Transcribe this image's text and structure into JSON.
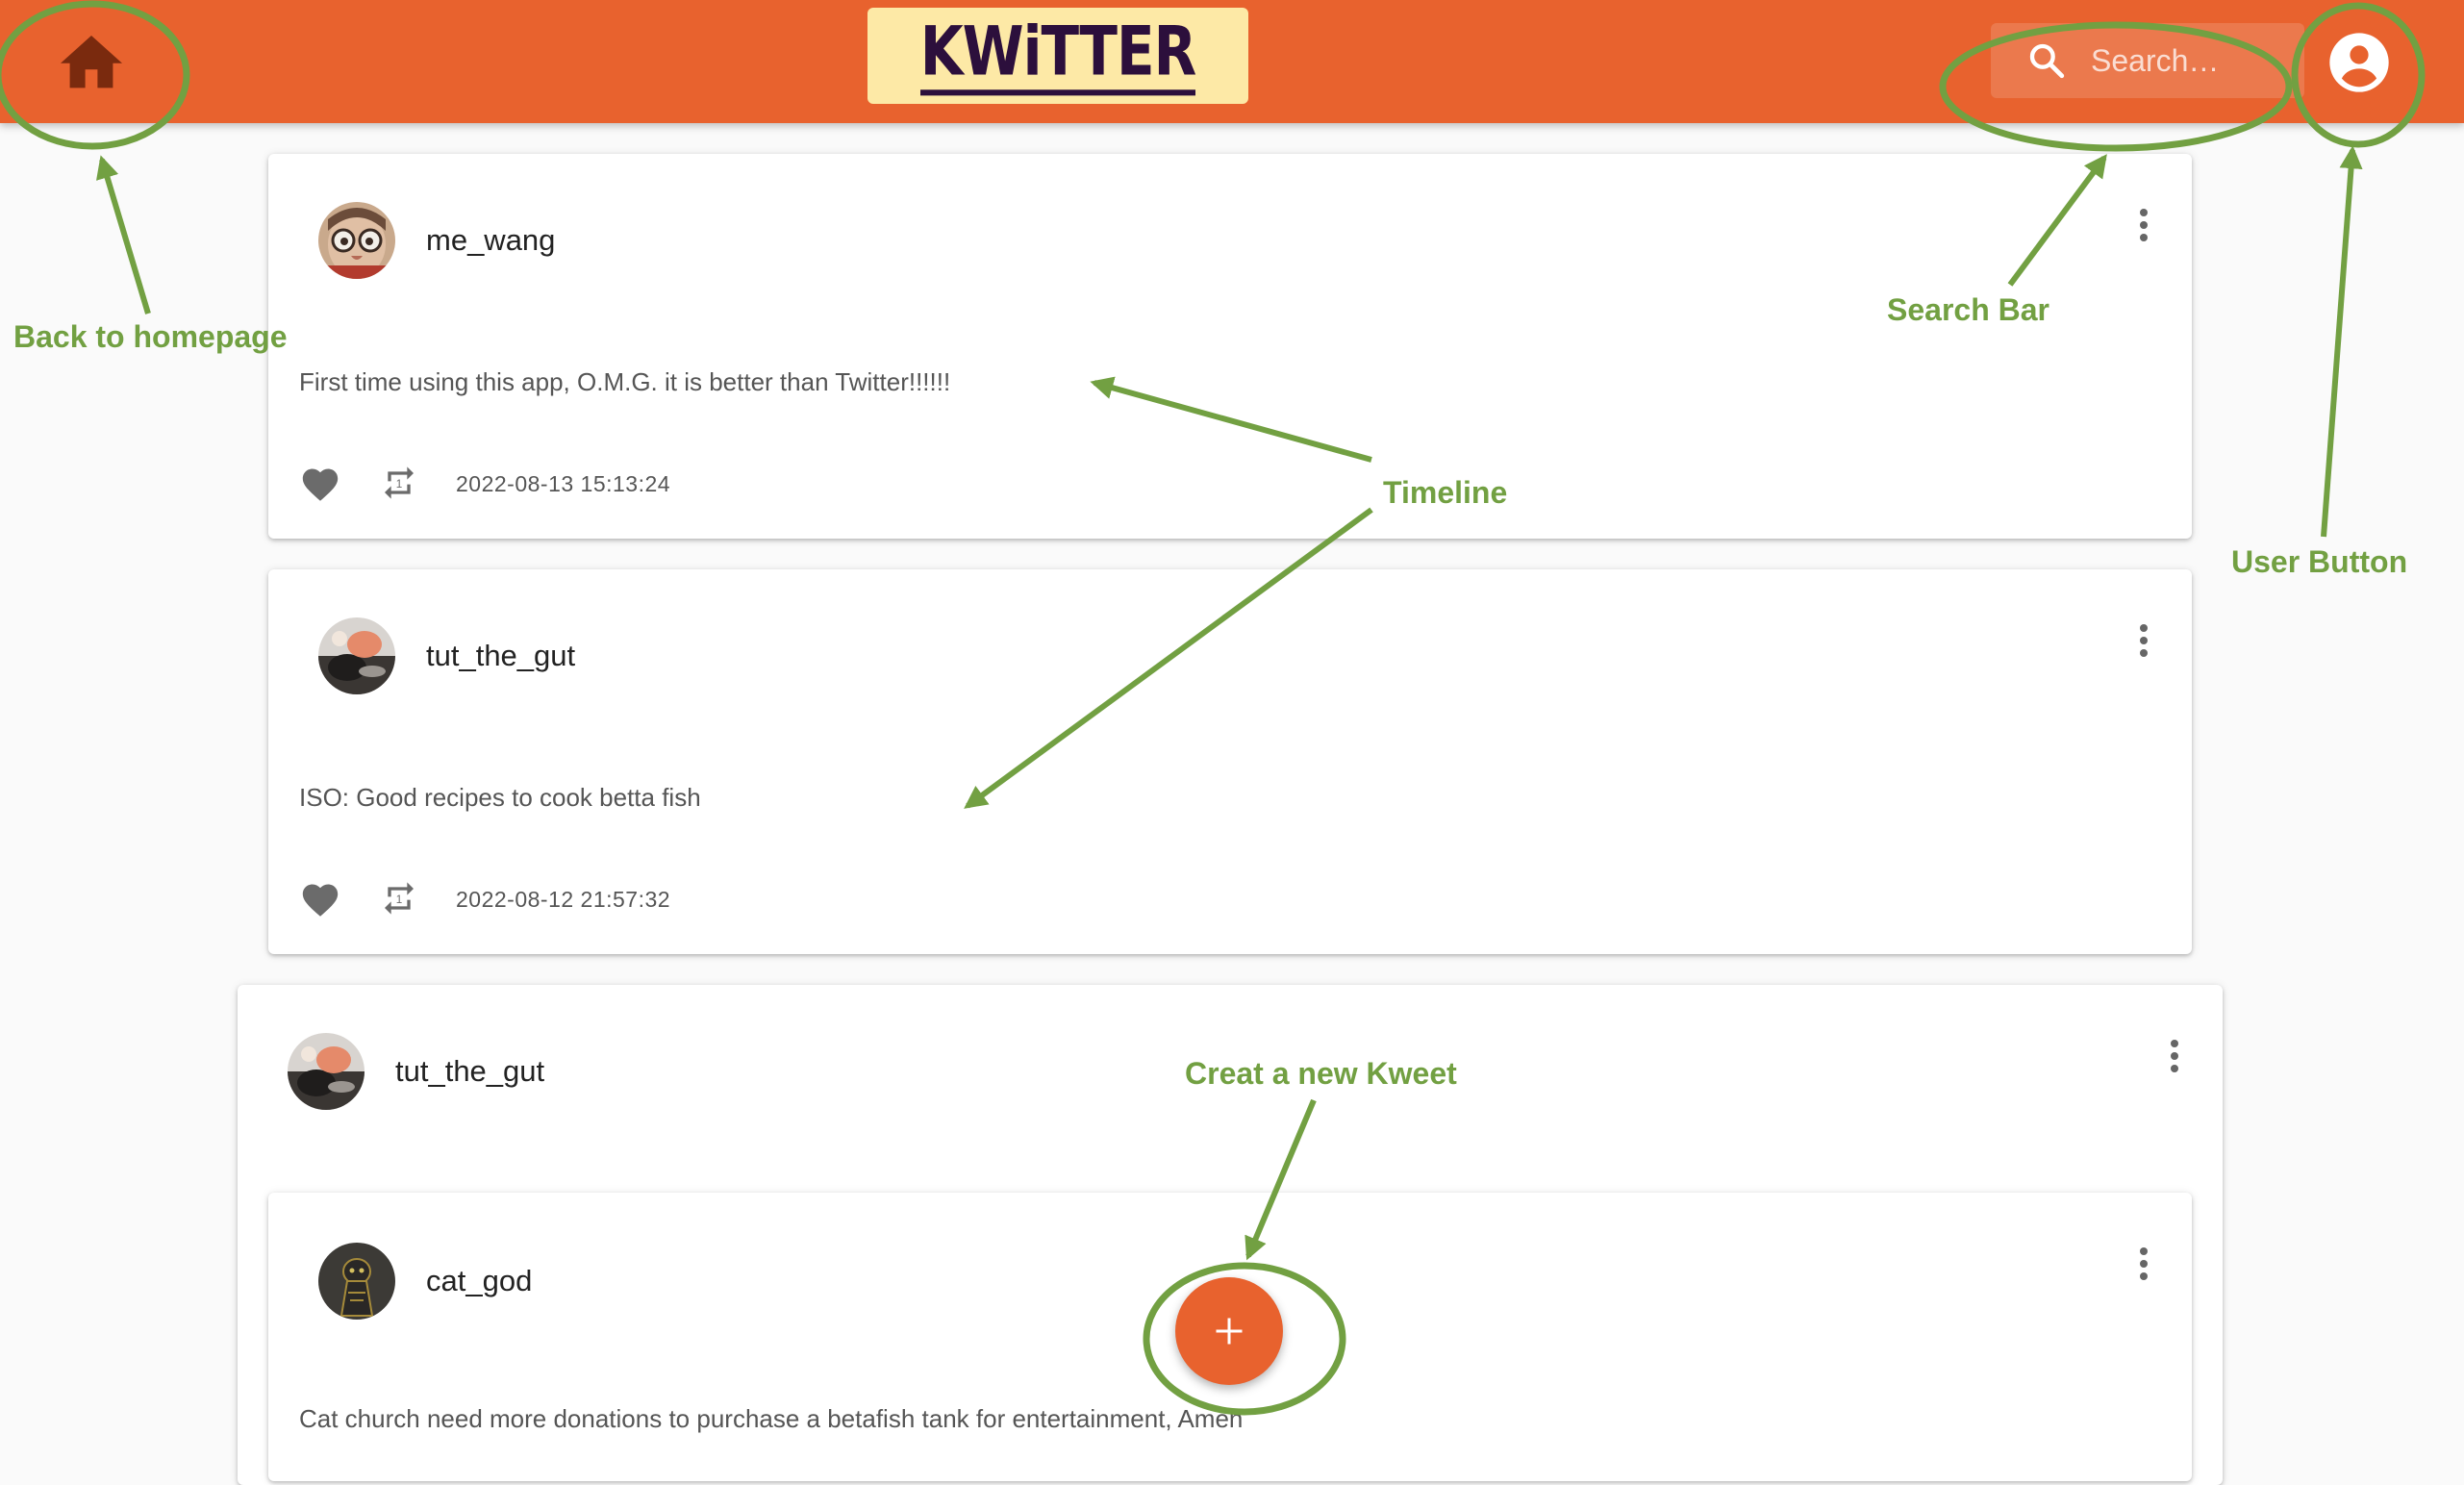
{
  "header": {
    "logo_text": "KWiTTER",
    "search_placeholder": "Search…"
  },
  "timeline": [
    {
      "username": "me_wang",
      "text": "First time using this app, O.M.G. it is better than Twitter!!!!!!",
      "timestamp": "2022-08-13 15:13:24"
    },
    {
      "username": "tut_the_gut",
      "text": "ISO: Good recipes to cook betta fish",
      "timestamp": "2022-08-12 21:57:32"
    },
    {
      "username": "tut_the_gut"
    },
    {
      "username": "cat_god",
      "text": "Cat church need more donations to purchase a betafish tank for entertainment, Amen"
    }
  ],
  "fab": {
    "symbol": "+"
  },
  "annotations": {
    "home": "Back to homepage",
    "search": "Search Bar",
    "timeline": "Timeline",
    "user": "User Button",
    "new_kweet": "Creat a new Kweet"
  },
  "colors": {
    "header": "#e8622e",
    "logo_background": "#fde9a6",
    "logo_text": "#2c0f3c",
    "annotation": "#72a042",
    "home_icon": "#7a2a0e"
  }
}
